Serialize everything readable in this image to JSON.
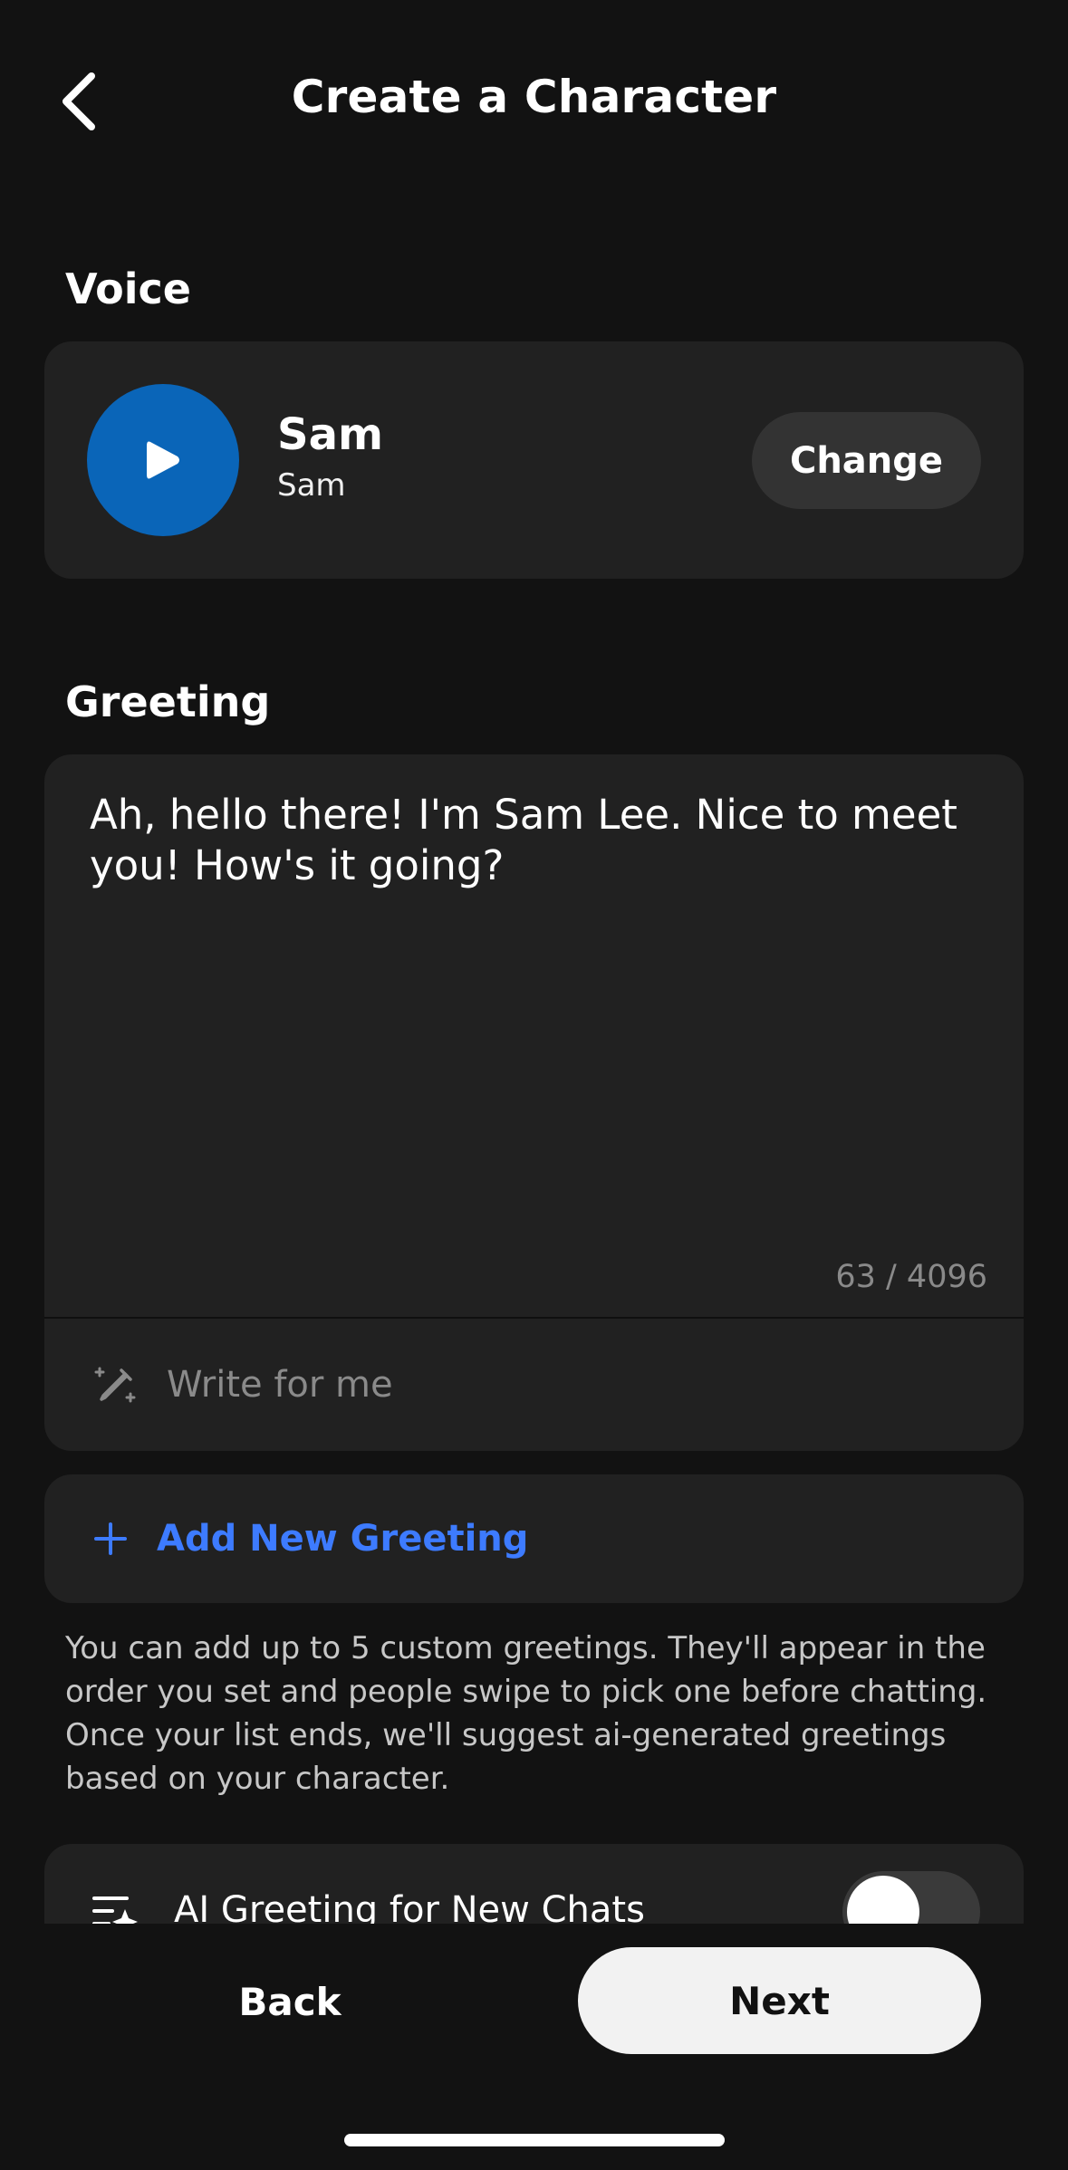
{
  "header": {
    "title": "Create a Character",
    "back_icon": "chevron-left-icon"
  },
  "voice": {
    "section_label": "Voice",
    "play_icon": "play-icon",
    "name": "Sam",
    "subtitle": "Sam",
    "change_label": "Change",
    "accent_color": "#0a65b8"
  },
  "greeting": {
    "section_label": "Greeting",
    "text": "Ah, hello there! I'm Sam Lee. Nice to meet you! How's it going?",
    "char_count": "63 / 4096",
    "write_for_me_label": "Write for me",
    "write_icon": "magic-pencil-icon"
  },
  "add_greeting": {
    "label": "Add New Greeting",
    "icon": "plus-icon",
    "color": "#3d7bff"
  },
  "info": {
    "text": "You can add up to 5 custom greetings. They'll appear in the order you set and people swipe to pick one before chatting. Once your list ends, we'll suggest ai-generated greetings based on your character."
  },
  "ai_greeting": {
    "label": "AI Greeting for New Chats",
    "icon": "ai-list-icon"
  },
  "footer": {
    "back_label": "Back",
    "next_label": "Next"
  }
}
